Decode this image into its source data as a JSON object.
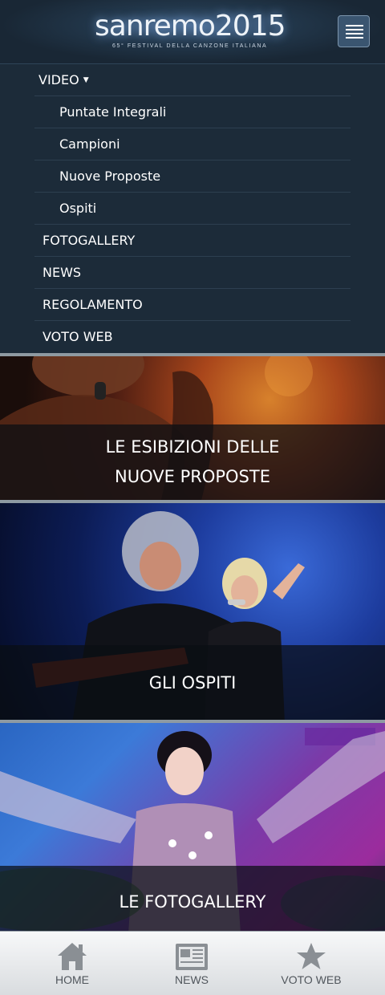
{
  "header": {
    "logo_main": "sanremo2015",
    "logo_sub": "65° FESTIVAL DELLA CANZONE ITALIANA",
    "menu_icon": "hamburger-icon"
  },
  "nav": {
    "video": "VIDEO",
    "video_subitems": [
      "Puntate Integrali",
      "Campioni",
      "Nuove Proposte",
      "Ospiti"
    ],
    "items": [
      "FOTOGALLERY",
      "NEWS",
      "REGOLAMENTO",
      "VOTO WEB"
    ]
  },
  "banners": [
    {
      "line1": "LE ESIBIZIONI DELLE",
      "line2": "NUOVE PROPOSTE"
    },
    {
      "line1": "GLI OSPITI"
    },
    {
      "line1": "LE FOTOGALLERY"
    }
  ],
  "tabbar": [
    {
      "label": "HOME",
      "icon": "home-icon"
    },
    {
      "label": "NEWS",
      "icon": "newspaper-icon"
    },
    {
      "label": "VOTO WEB",
      "icon": "star-icon"
    }
  ],
  "colors": {
    "header_bg": "#1b2a38",
    "nav_bg": "#1c2b39",
    "nav_divider": "#2d3f50",
    "tabbar_bg": "#e6e8ea"
  }
}
